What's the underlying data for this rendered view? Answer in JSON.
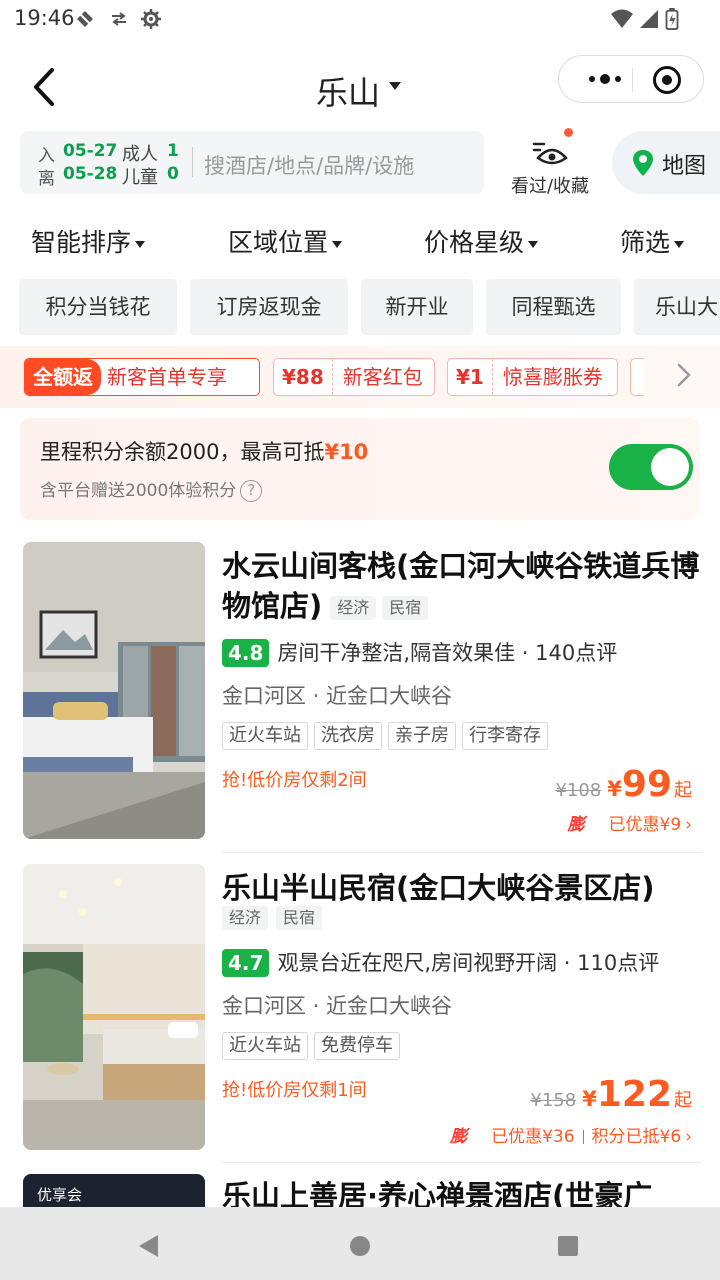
{
  "status_bar": {
    "time": "19:46",
    "icons": [
      "signal-off-icon",
      "data-arrows-icon",
      "gear-icon",
      "wifi-icon",
      "cell-signal-icon",
      "battery-icon"
    ]
  },
  "nav": {
    "city": "乐山",
    "back_icon": "chevron-left-icon",
    "more_icon": "more-dots-icon",
    "close_icon": "target-icon"
  },
  "search": {
    "checkin_label": "入",
    "checkin_date": "05-27",
    "checkout_label": "离",
    "checkout_date": "05-28",
    "adults_label": "成人",
    "adults": "1",
    "children_label": "儿童",
    "children": "0",
    "placeholder": "搜酒店/地点/品牌/设施",
    "favorites_label": "看过/收藏",
    "map_label": "地图"
  },
  "sort": {
    "items": [
      "智能排序",
      "区域位置",
      "价格星级",
      "筛选"
    ]
  },
  "chips": [
    "积分当钱花",
    "订房返现金",
    "新开业",
    "同程甄选",
    "乐山大"
  ],
  "coupons": [
    {
      "tag": "全额返",
      "text": "新客首单专享"
    },
    {
      "tag": "¥88",
      "text": "新客红包"
    },
    {
      "tag": "¥1",
      "text": "惊喜膨胀券"
    }
  ],
  "points": {
    "line1": "里程积分余额2000，最高可抵",
    "amount": "¥10",
    "line2": "含平台赠送2000体验积分",
    "help": "?",
    "toggle_on": true
  },
  "hotels": [
    {
      "name": "水云山间客栈(金口河大峡谷铁道兵博物馆店)",
      "types": [
        "经济",
        "民宿"
      ],
      "score": "4.8",
      "review": "房间干净整洁,隔音效果佳 · 140点评",
      "location": "金口河区 · 近金口大峡谷",
      "tags": [
        "近火车站",
        "洗衣房",
        "亲子房",
        "行李寄存"
      ],
      "urgent": "抢!低价房仅剩2间",
      "original_price": "¥108",
      "currency": "¥",
      "price": "99",
      "price_suffix": "起",
      "swell": "膨",
      "discount": "已优惠¥9",
      "points_used": ""
    },
    {
      "name": "乐山半山民宿(金口大峡谷景区店)",
      "types": [
        "经济",
        "民宿"
      ],
      "score": "4.7",
      "review": "观景台近在咫尺,房间视野开阔 · 110点评",
      "location": "金口河区 · 近金口大峡谷",
      "tags": [
        "近火车站",
        "免费停车"
      ],
      "urgent": "抢!低价房仅剩1间",
      "original_price": "¥158",
      "currency": "¥",
      "price": "122",
      "price_suffix": "起",
      "swell": "膨",
      "discount": "已优惠¥36",
      "points_used": "积分已抵¥6"
    },
    {
      "name": "乐山上善居·养心禅景酒店(世豪广",
      "badge": "优享会"
    }
  ],
  "system_nav": [
    "back-triangle-icon",
    "home-circle-icon",
    "recents-square-icon"
  ]
}
